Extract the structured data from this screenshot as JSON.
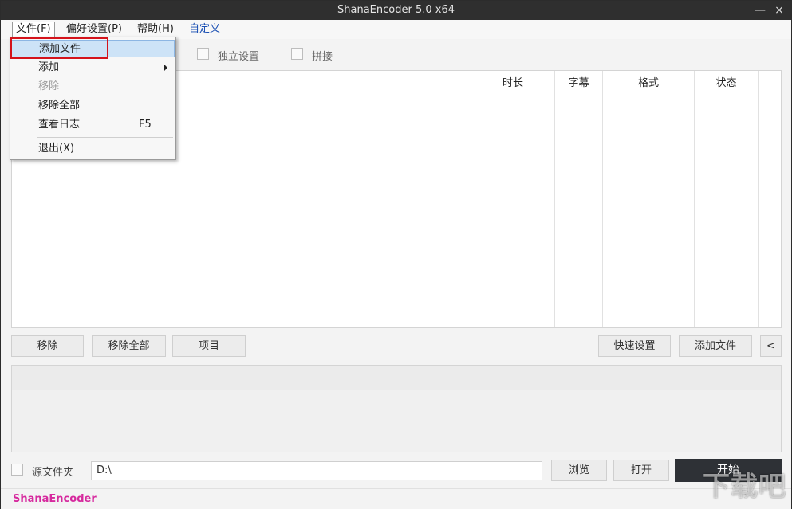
{
  "window": {
    "title": "ShanaEncoder 5.0 x64",
    "minimize": "—",
    "close": "×"
  },
  "menu": {
    "file": "文件(F)",
    "prefs": "偏好设置(P)",
    "help": "帮助(H)",
    "custom": "自定义"
  },
  "file_menu": {
    "items": [
      {
        "label": "添加文件",
        "shortcut": ""
      },
      {
        "label": "添加",
        "shortcut": ""
      },
      {
        "label": "移除",
        "shortcut": ""
      },
      {
        "label": "移除全部",
        "shortcut": ""
      },
      {
        "label": "查看日志",
        "shortcut": "F5"
      },
      {
        "label": "退出(X)",
        "shortcut": ""
      }
    ]
  },
  "options": {
    "independent": "独立设置",
    "join": "拼接"
  },
  "table": {
    "columns": [
      "时长",
      "字幕",
      "格式",
      "状态"
    ]
  },
  "buttons": {
    "remove": "移除",
    "remove_all": "移除全部",
    "project": "项目",
    "quick_settings": "快速设置",
    "add_file": "添加文件",
    "collapse": "<",
    "browse": "浏览",
    "open": "打开",
    "start": "开始"
  },
  "output": {
    "source_folder": "源文件夹",
    "path": "D:\\"
  },
  "status": {
    "brand": "ShanaEncoder"
  },
  "watermark": "下载吧"
}
